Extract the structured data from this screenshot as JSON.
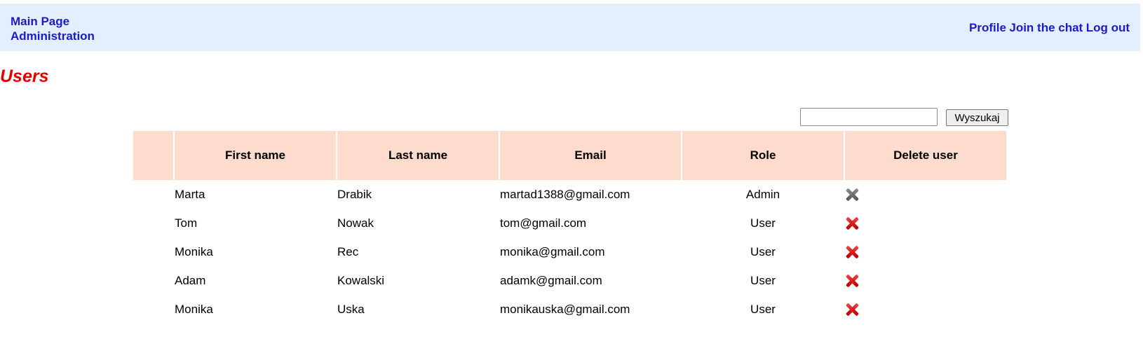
{
  "nav": {
    "left": [
      "Main Page",
      "Administration"
    ],
    "right": [
      "Profile",
      "Join the chat",
      "Log out"
    ]
  },
  "page_title": "Users",
  "search": {
    "button_label": "Wyszukaj",
    "value": ""
  },
  "table": {
    "headers": [
      "",
      "First name",
      "Last name",
      "Email",
      "Role",
      "Delete user"
    ],
    "rows": [
      {
        "first": "Marta",
        "last": "Drabik",
        "email": "martad1388@gmail.com",
        "role": "Admin",
        "delete_icon": "delete-disabled-icon"
      },
      {
        "first": "Tom",
        "last": "Nowak",
        "email": "tom@gmail.com",
        "role": "User",
        "delete_icon": "delete-icon"
      },
      {
        "first": "Monika",
        "last": "Rec",
        "email": "monika@gmail.com",
        "role": "User",
        "delete_icon": "delete-icon"
      },
      {
        "first": "Adam",
        "last": "Kowalski",
        "email": "adamk@gmail.com",
        "role": "User",
        "delete_icon": "delete-icon"
      },
      {
        "first": "Monika",
        "last": "Uska",
        "email": "monikauska@gmail.com",
        "role": "User",
        "delete_icon": "delete-icon"
      }
    ]
  },
  "colors": {
    "nav_bg": "#e3effd",
    "link": "#1a1ac8",
    "title": "#e10000",
    "header_bg": "#fddccd"
  }
}
